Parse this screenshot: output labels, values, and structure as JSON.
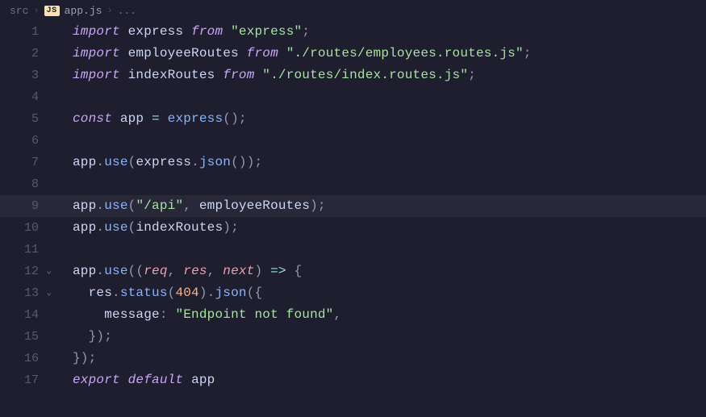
{
  "breadcrumb": {
    "folder": "src",
    "badge": "JS",
    "file": "app.js",
    "more": "..."
  },
  "lines": {
    "1": "1",
    "2": "2",
    "3": "3",
    "4": "4",
    "5": "5",
    "6": "6",
    "7": "7",
    "8": "8",
    "9": "9",
    "10": "10",
    "11": "11",
    "12": "12",
    "13": "13",
    "14": "14",
    "15": "15",
    "16": "16",
    "17": "17"
  },
  "tok": {
    "import": "import",
    "from": "from",
    "const": "const",
    "export": "export",
    "default": "default",
    "express_id": "express",
    "employeeRoutes": "employeeRoutes",
    "indexRoutes": "indexRoutes",
    "app": "app",
    "req": "req",
    "res": "res",
    "next": "next",
    "use": "use",
    "json": "json",
    "status": "status",
    "message": "message",
    "str_express": "\"express\"",
    "str_emp": "\"./routes/employees.routes.js\"",
    "str_idx": "\"./routes/index.routes.js\"",
    "str_api": "\"/api\"",
    "str_nf": "\"Endpoint not found\"",
    "n404": "404",
    "eq": " = ",
    "arrow": " => ",
    "dot": ".",
    "comma": ",",
    "comma_sp": ", ",
    "semi": ";",
    "colon_sp": ": ",
    "lpar": "(",
    "rpar": ")",
    "lbr": "{",
    "rbr": "}",
    "lpar_lbr": "({",
    "rbr_rpar_semi": "});",
    "rpar_rpar_semi": "());",
    "rpar_semi": ");",
    "lpar_rpar_semi": "();",
    "sp": " "
  }
}
